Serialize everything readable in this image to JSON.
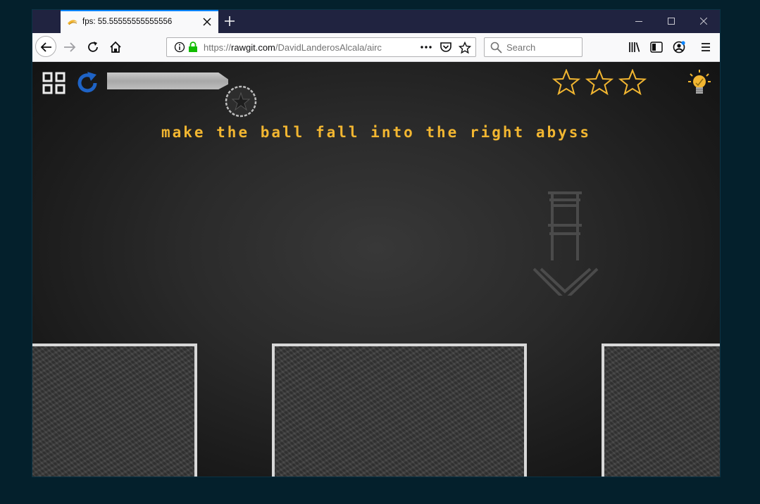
{
  "browser": {
    "tab_title": "fps: 55.55555555555556",
    "url_prefix": "https://",
    "url_host": "rawgit.com",
    "url_path": "/DavidLanderosAlcala/airc",
    "search_placeholder": "Search"
  },
  "game": {
    "instruction": "make the ball fall into the right abyss",
    "stars_total": 3,
    "stars_earned": 0,
    "colors": {
      "accent": "#f2b631",
      "reload": "#1e63c6",
      "chalk": "#d8d8d8",
      "board": "#2a2a2a"
    },
    "icons": [
      "menu-grid-icon",
      "reload-icon",
      "star-icon",
      "hint-bulb-icon",
      "down-arrow-icon"
    ]
  }
}
